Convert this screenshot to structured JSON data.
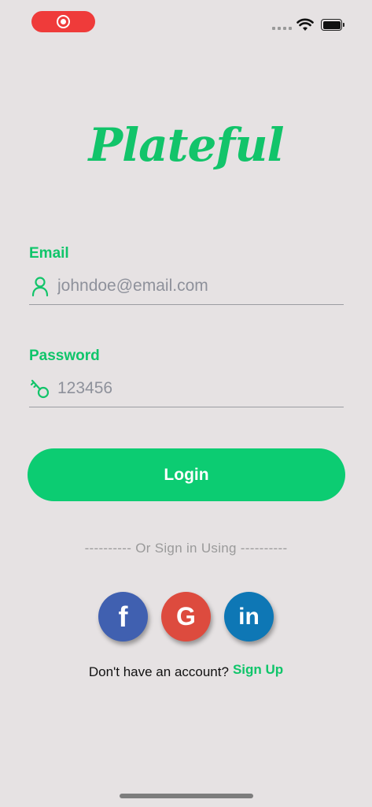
{
  "status_bar": {
    "record_icon": "screen-record-icon",
    "signal_icon": "cellular-signal-icon",
    "wifi_icon": "wifi-icon",
    "battery_icon": "battery-icon"
  },
  "logo": {
    "text": "Plateful"
  },
  "email": {
    "label": "Email",
    "placeholder": "johndoe@email.com",
    "icon": "user-icon"
  },
  "password": {
    "label": "Password",
    "placeholder": "123456",
    "icon": "key-icon"
  },
  "login": {
    "label": "Login"
  },
  "divider": {
    "text": "---------- Or Sign in Using ----------"
  },
  "social": {
    "facebook": "f",
    "google": "G",
    "linkedin": "in"
  },
  "signup": {
    "prompt": "Don't have an account?",
    "link": "Sign Up"
  },
  "colors": {
    "accent": "#0ccc72",
    "background": "#e6e2e3",
    "facebook": "#4060b0",
    "google": "#dd4b3e",
    "linkedin": "#0e77b5",
    "record": "#ef3b3a"
  }
}
